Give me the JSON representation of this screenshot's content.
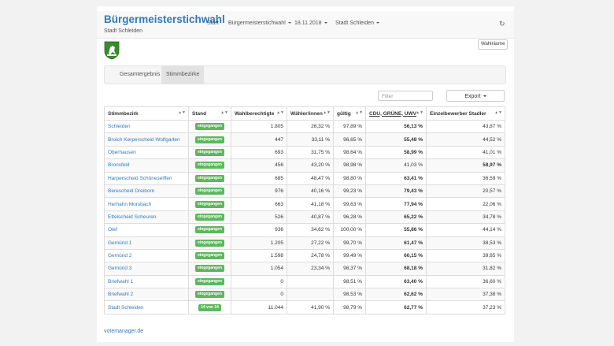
{
  "header": {
    "title": "Bürgermeisterstichwahl",
    "subtitle": "Stadt Schleiden",
    "nav": {
      "start": "Start",
      "election": "Bürgermeisterstichwahl",
      "date": "18.11.2018",
      "area": "Stadt Schleiden"
    },
    "refresh_icon": "refresh-icon"
  },
  "toolbar": {
    "wahlraeume_label": "Wahlräume",
    "tabs": [
      "Gesamtergebnis",
      "Stimmbezirke"
    ],
    "active_tab": "Stimmbezirke",
    "filter_placeholder": "Filter",
    "export_label": "Export"
  },
  "table": {
    "columns": [
      "Stimmbezirk",
      "Stand",
      "Wahlberechtigte",
      "Wähler/innen",
      "gültig",
      "CDU, GRÜNE, UWV",
      "Einzelbewerber Stadler"
    ],
    "rows": [
      {
        "name": "Schleiden",
        "status": "eingegangen",
        "eligible": "1.805",
        "voters": "26,32 %",
        "valid": "97,89 %",
        "cdu": "56,13 %",
        "stadler": "43,87 %"
      },
      {
        "name": "Broich Kerperscheid Wolfgarten",
        "status": "eingegangen",
        "eligible": "447",
        "voters": "33,11 %",
        "valid": "96,65 %",
        "cdu": "55,48 %",
        "stadler": "44,52 %"
      },
      {
        "name": "Oberhausen",
        "status": "eingegangen",
        "eligible": "693",
        "voters": "31,75 %",
        "valid": "98,64 %",
        "cdu": "58,99 %",
        "stadler": "41,01 %"
      },
      {
        "name": "Bronsfeld",
        "status": "eingegangen",
        "eligible": "456",
        "voters": "43,20 %",
        "valid": "98,98 %",
        "cdu": "41,03 %",
        "stadler": "58,97 %"
      },
      {
        "name": "Harperscheid Schöneseiffen",
        "status": "eingegangen",
        "eligible": "685",
        "voters": "48,47 %",
        "valid": "98,80 %",
        "cdu": "63,41 %",
        "stadler": "36,59 %"
      },
      {
        "name": "Berescheid Dreiborn",
        "status": "eingegangen",
        "eligible": "976",
        "voters": "40,16 %",
        "valid": "99,23 %",
        "cdu": "79,43 %",
        "stadler": "20,57 %"
      },
      {
        "name": "Herhahn Morsbach",
        "status": "eingegangen",
        "eligible": "663",
        "voters": "41,18 %",
        "valid": "99,63 %",
        "cdu": "77,94 %",
        "stadler": "22,06 %"
      },
      {
        "name": "Ettelscheid Scheuren",
        "status": "eingegangen",
        "eligible": "526",
        "voters": "40,87 %",
        "valid": "96,28 %",
        "cdu": "65,22 %",
        "stadler": "34,78 %"
      },
      {
        "name": "Olef",
        "status": "eingegangen",
        "eligible": "936",
        "voters": "34,62 %",
        "valid": "100,00 %",
        "cdu": "55,86 %",
        "stadler": "44,14 %"
      },
      {
        "name": "Gemünd 1",
        "status": "eingegangen",
        "eligible": "1.205",
        "voters": "27,22 %",
        "valid": "99,70 %",
        "cdu": "61,47 %",
        "stadler": "38,53 %"
      },
      {
        "name": "Gemünd 2",
        "status": "eingegangen",
        "eligible": "1.598",
        "voters": "24,78 %",
        "valid": "99,49 %",
        "cdu": "60,15 %",
        "stadler": "39,85 %"
      },
      {
        "name": "Gemünd 3",
        "status": "eingegangen",
        "eligible": "1.054",
        "voters": "23,34 %",
        "valid": "98,37 %",
        "cdu": "68,18 %",
        "stadler": "31,82 %"
      },
      {
        "name": "Briefwahl 1",
        "status": "eingegangen",
        "eligible": "0",
        "voters": "",
        "valid": "98,51 %",
        "cdu": "63,40 %",
        "stadler": "36,60 %"
      },
      {
        "name": "Briefwahl 2",
        "status": "eingegangen",
        "eligible": "0",
        "voters": "",
        "valid": "98,53 %",
        "cdu": "62,62 %",
        "stadler": "37,38 %"
      },
      {
        "name": "Stadt Schleiden",
        "status": "14 von 14",
        "eligible": "11.044",
        "voters": "41,90 %",
        "valid": "98,79 %",
        "cdu": "62,77 %",
        "stadler": "37,23 %"
      }
    ]
  },
  "footer": {
    "link": "votemanager.de"
  },
  "colors": {
    "accent": "#337ab7",
    "success": "#5cb85c"
  }
}
